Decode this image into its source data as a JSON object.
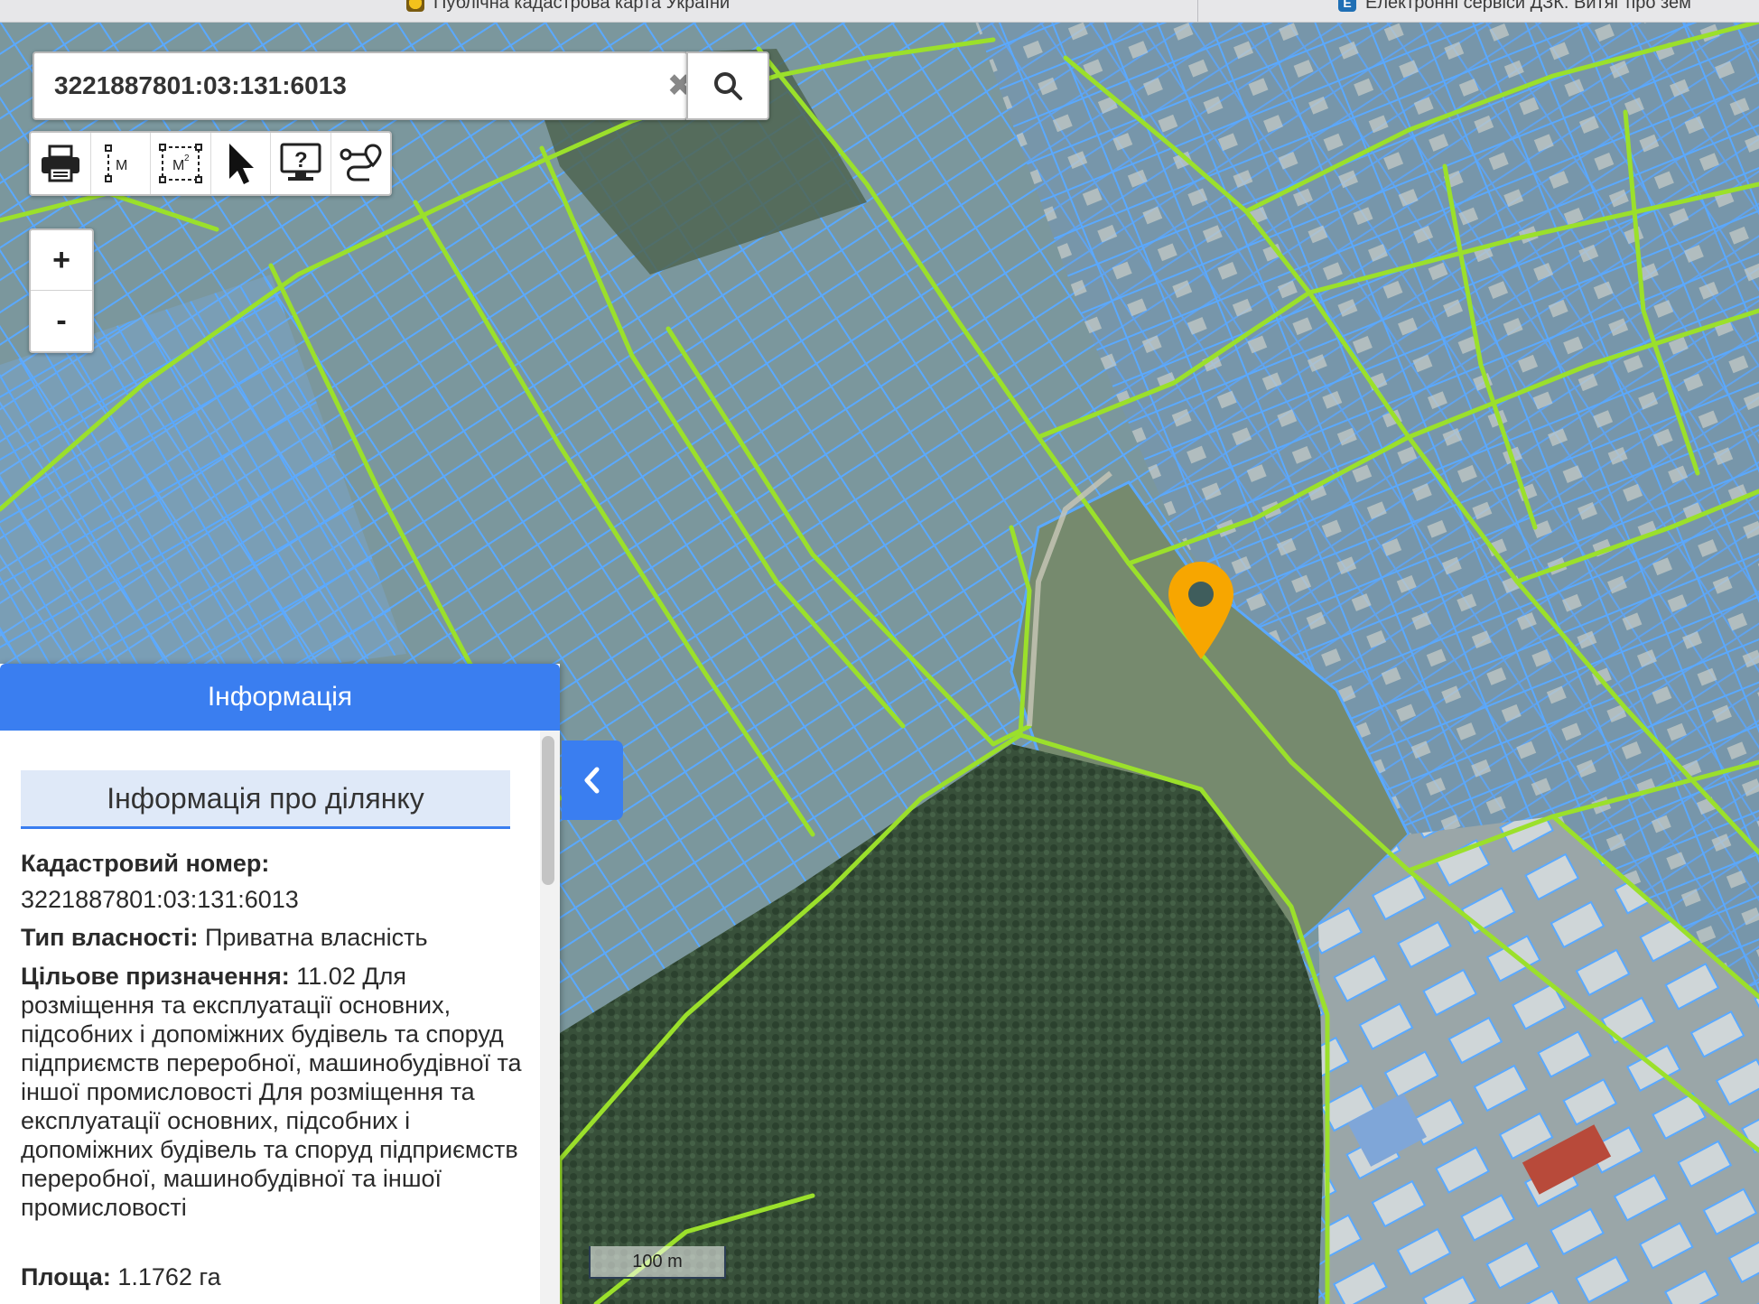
{
  "browser": {
    "tab1_title": "Публічна кадастрова карта України",
    "tab2_title": "Електронні сервіси ДЗК. Витяг про зем"
  },
  "search": {
    "value": "3221887801:03:131:6013",
    "clear_symbol": "✖"
  },
  "toolbar": {
    "tools": [
      "print-icon",
      "measure-length-icon",
      "measure-area-icon",
      "pointer-icon",
      "identify-icon",
      "route-icon"
    ],
    "measure_length_label": "M",
    "measure_area_label": "M",
    "identify_label": "?"
  },
  "zoom": {
    "in_label": "+",
    "out_label": "-"
  },
  "info_panel": {
    "header": "Інформація",
    "subheader": "Інформація про ділянку",
    "cadastral_label": "Кадастровий номер:",
    "cadastral_value": "3221887801:03:131:6013",
    "ownership_label": "Тип власності:",
    "ownership_value": "Приватна власність",
    "purpose_label": "Цільове призначення:",
    "purpose_value": "11.02 Для розміщення та експлуатації основних, підсобних і допоміжних будівель та споруд підприємств переробної, машинобудівної та іншої промисловості Для розміщення та експлуатації основних, підсобних і допоміжних будівель та споруд підприємств переробної, машинобудівної та іншої промисловості",
    "area_label": "Площа:",
    "area_value": "1.1762 га"
  },
  "scale_label": "100 m",
  "colors": {
    "accent": "#3a7ef0",
    "parcel_outline": "#5aa9ff",
    "road_outline": "#9be02b",
    "marker": "#f7a600"
  }
}
